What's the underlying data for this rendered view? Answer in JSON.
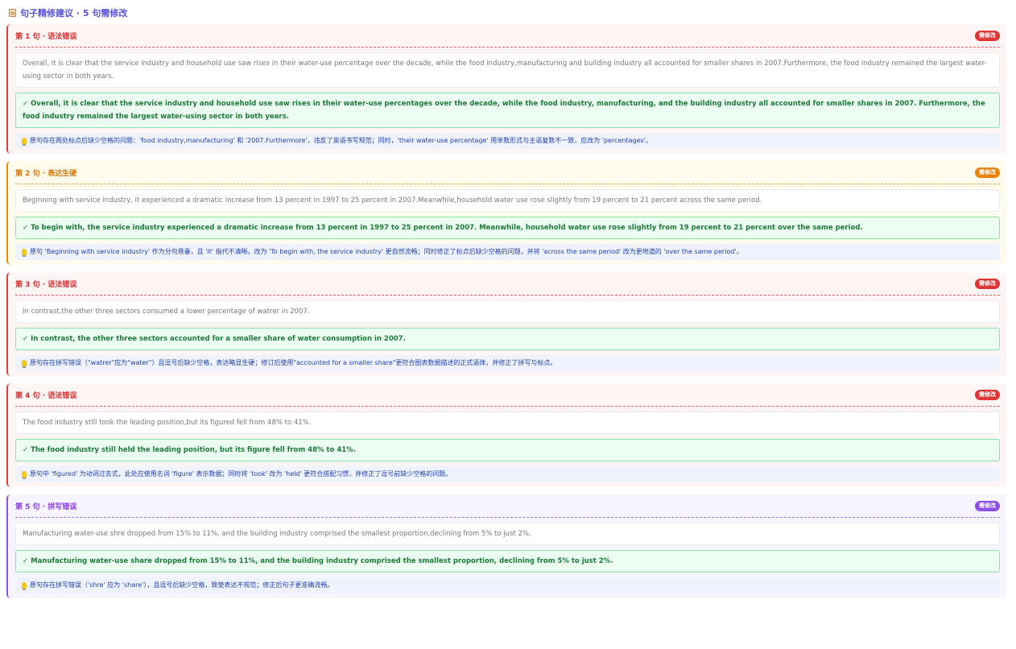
{
  "header": {
    "title": "句子精修建议 · 5 句需修改"
  },
  "cards": [
    {
      "title": "第 1 句 · 语法错误",
      "badge": "需修改",
      "original": "Overall, it is clear that the service industry and household use saw rises in their water-use percentage over the decade, while the food industry,manufacturing and building industry all accounted for smaller shares in 2007.Furthermore, the food industry remained the largest water-using sector in both years.",
      "revised": "✓ Overall, it is clear that the service industry and household use saw rises in their water-use percentages over the decade, while the food industry, manufacturing, and the building industry all accounted for smaller shares in 2007. Furthermore, the food industry remained the largest water-using sector in both years.",
      "note": "原句存在两处标点后缺少空格的问题：'food industry,manufacturing' 和 '2007.Furthermore'，违反了英语书写规范；同时，'their water-use percentage' 用单数形式与主语复数不一致，应改为 'percentages'。"
    },
    {
      "title": "第 2 句 · 表达生硬",
      "badge": "需修改",
      "original": "Beginning with service industry, it experienced a dramatic increase from 13 percent in 1997 to 25 percent in 2007.Meanwhile,household water use rose slightly from 19 percent to 21 percent across the same period.",
      "revised": "✓ To begin with, the service industry experienced a dramatic increase from 13 percent in 1997 to 25 percent in 2007. Meanwhile, household water use rose slightly from 19 percent to 21 percent over the same period.",
      "note": "原句 'Beginning with service industry' 作为分句悬垂，且 'it' 指代不清晰。改为 'To begin with, the service industry' 更自然流畅；同时修正了标点后缺少空格的问题，并将 'across the same period' 改为更地道的 'over the same period'。"
    },
    {
      "title": "第 3 句 · 语法错误",
      "badge": "需修改",
      "original": "In contrast,the other three sectors consumed a lower percentage of watrer in 2007.",
      "revised": "✓ In contrast, the other three sectors accounted for a smaller share of water consumption in 2007.",
      "note": "原句存在拼写错误（\"watrer\"应为\"water\"）且逗号后缺少空格，表达略显生硬；修订后使用\"accounted for a smaller share\"更符合图表数据描述的正式语体，并修正了拼写与标点。"
    },
    {
      "title": "第 4 句 · 语法错误",
      "badge": "需修改",
      "original": "The food industry still took the leading position,but its figured fell from 48% to 41%.",
      "revised": "✓ The food industry still held the leading position, but its figure fell from 48% to 41%.",
      "note": "原句中 'figured' 为动词过去式，此处应使用名词 'figure' 表示数据；同时将 'took' 改为 'held' 更符合搭配习惯，并修正了逗号前缺少空格的问题。"
    },
    {
      "title": "第 5 句 · 拼写错误",
      "badge": "需修改",
      "original": "Manufacturing water-use shre dropped from 15% to 11%, and the building industry comprised the smallest proportion,declining from 5% to just 2%.",
      "revised": "✓ Manufacturing water-use share dropped from 15% to 11%, and the building industry comprised the smallest proportion, declining from 5% to just 2%.",
      "note": "原句存在拼写错误（'shre' 应为 'share'），且逗号后缺少空格，致使表达不规范；修正后句子更准确流畅。"
    }
  ]
}
